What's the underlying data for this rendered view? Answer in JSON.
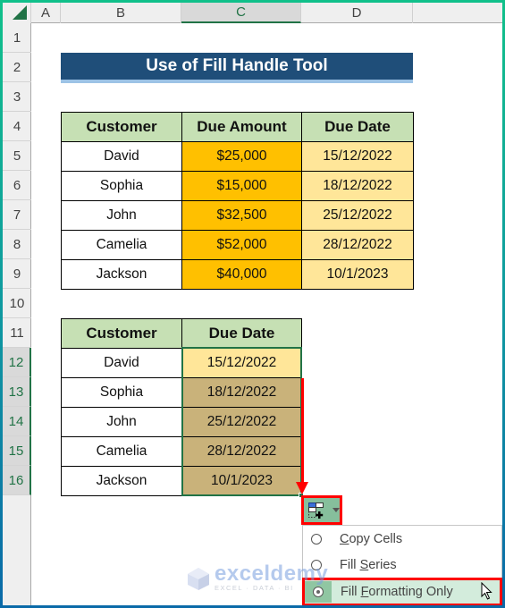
{
  "columns": [
    "A",
    "B",
    "C",
    "D"
  ],
  "selected_column": "C",
  "rows": [
    "1",
    "2",
    "3",
    "4",
    "5",
    "6",
    "7",
    "8",
    "9",
    "10",
    "11",
    "12",
    "13",
    "14",
    "15",
    "16"
  ],
  "selected_rows": [
    "12",
    "13",
    "14",
    "15",
    "16"
  ],
  "title": "Use of Fill Handle Tool",
  "table1": {
    "headers": [
      "Customer",
      "Due Amount",
      "Due Date"
    ],
    "rows": [
      {
        "customer": "David",
        "amount": "$25,000",
        "date": "15/12/2022"
      },
      {
        "customer": "Sophia",
        "amount": "$15,000",
        "date": "18/12/2022"
      },
      {
        "customer": "John",
        "amount": "$32,500",
        "date": "25/12/2022"
      },
      {
        "customer": "Camelia",
        "amount": "$52,000",
        "date": "28/12/2022"
      },
      {
        "customer": "Jackson",
        "amount": "$40,000",
        "date": "10/1/2023"
      }
    ]
  },
  "table2": {
    "headers": [
      "Customer",
      "Due Date"
    ],
    "rows": [
      {
        "customer": "David",
        "date": "15/12/2022"
      },
      {
        "customer": "Sophia",
        "date": "18/12/2022"
      },
      {
        "customer": "John",
        "date": "25/12/2022"
      },
      {
        "customer": "Camelia",
        "date": "28/12/2022"
      },
      {
        "customer": "Jackson",
        "date": "10/1/2023"
      }
    ]
  },
  "autofill_menu": {
    "button_icon": "auto-fill-options-icon",
    "items": [
      {
        "pre": "",
        "ul": "C",
        "post": "opy Cells",
        "selected": false
      },
      {
        "pre": "Fill ",
        "ul": "S",
        "post": "eries",
        "selected": false
      },
      {
        "pre": "Fill ",
        "ul": "F",
        "post": "ormatting Only",
        "selected": true
      }
    ]
  },
  "watermark": {
    "name": "exceldemy",
    "tagline": "EXCEL · DATA · BI"
  },
  "colors": {
    "title_bg": "#1f4e79",
    "header_bg": "#c6e0b4",
    "amount_bg": "#ffc000",
    "date_bg": "#ffe699",
    "filled_bg": "#c9b27a",
    "highlight_red": "#ff0000",
    "excel_green": "#217346"
  }
}
